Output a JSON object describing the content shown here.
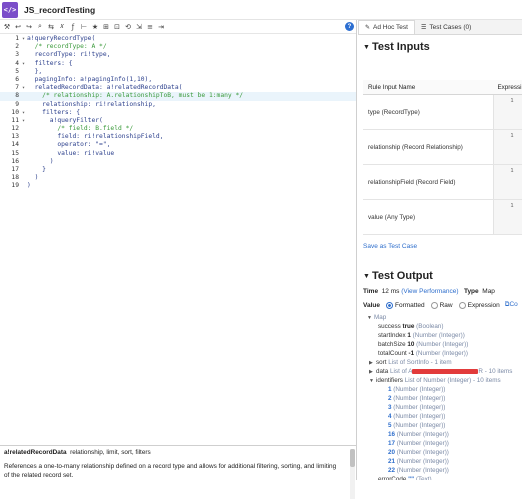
{
  "titlebar": {
    "icon": "</>",
    "title": "JS_recordTesting"
  },
  "toolbar": {
    "buttons": [
      "⚒",
      "↩",
      "↪",
      "⌕",
      "⇆",
      "𝑥",
      "ƒ",
      "⊢",
      "★",
      "⊞",
      "⊡",
      "⟲",
      "⇲",
      "≡",
      "⇥"
    ],
    "help": "?"
  },
  "code": {
    "lines": [
      {
        "n": "1",
        "fold": "▾",
        "text": "a!queryRecordType(",
        "cls": "c-fn"
      },
      {
        "n": "2",
        "fold": "",
        "text": "  /* recordType: A */",
        "cls": "c-comment"
      },
      {
        "n": "3",
        "fold": "",
        "text": "  recordType: ri!type,",
        "cls": "code-text"
      },
      {
        "n": "4",
        "fold": "▾",
        "text": "  filters: {",
        "cls": "code-text"
      },
      {
        "n": "5",
        "fold": "",
        "text": "  },",
        "cls": "code-text"
      },
      {
        "n": "6",
        "fold": "",
        "text": "  pagingInfo: a!pagingInfo(1,10),",
        "cls": "code-text"
      },
      {
        "n": "7",
        "fold": "▾",
        "text": "  relatedRecordData: a!relatedRecordData(",
        "cls": "code-text"
      },
      {
        "n": "8",
        "fold": "",
        "text": "    /* relationship: A.relationshipToB, must be 1:many */",
        "cls": "c-comment"
      },
      {
        "n": "9",
        "fold": "",
        "text": "    relationship: ri!relationship,",
        "cls": "code-text"
      },
      {
        "n": "10",
        "fold": "▾",
        "text": "    filters: {",
        "cls": "code-text"
      },
      {
        "n": "11",
        "fold": "▾",
        "text": "      a!queryFilter(",
        "cls": "code-text"
      },
      {
        "n": "12",
        "fold": "",
        "text": "        /* field: B.field */",
        "cls": "c-comment"
      },
      {
        "n": "13",
        "fold": "",
        "text": "        field: ri!relationshipField,",
        "cls": "code-text"
      },
      {
        "n": "14",
        "fold": "",
        "text": "        operator: \"=\",",
        "cls": "code-text"
      },
      {
        "n": "15",
        "fold": "",
        "text": "        value: ri!value",
        "cls": "code-text"
      },
      {
        "n": "16",
        "fold": "",
        "text": "      )",
        "cls": "code-text"
      },
      {
        "n": "17",
        "fold": "",
        "text": "    }",
        "cls": "code-text"
      },
      {
        "n": "18",
        "fold": "",
        "text": "  )",
        "cls": "code-text"
      },
      {
        "n": "19",
        "fold": "",
        "text": ")",
        "cls": "code-text"
      }
    ]
  },
  "doc": {
    "fn_name": "a!relatedRecordData",
    "params": "relationship, limit, sort, filters",
    "description": "References a one-to-many relationship defined on a record type and allows for additional filtering, sorting, and limiting of the related record set."
  },
  "tabs": [
    {
      "icon": "✎",
      "label": "Ad Hoc Test",
      "active": true
    },
    {
      "icon": "☰",
      "label": "Test Cases (0)",
      "active": false
    }
  ],
  "test_inputs": {
    "title": "Test Inputs",
    "col_name": "Rule Input Name",
    "col_expr": "Expressi",
    "rows": [
      {
        "name": "type (RecordType)",
        "line": "1"
      },
      {
        "name": "relationship (Record Relationship)",
        "line": "1"
      },
      {
        "name": "relationshipField (Record Field)",
        "line": "1"
      },
      {
        "name": "value (Any Type)",
        "line": "1"
      }
    ],
    "save_link": "Save as Test Case"
  },
  "test_output": {
    "title": "Test Output",
    "time_label": "Time",
    "time_value": "12 ms",
    "perf_link": "(View Performance)",
    "type_label": "Type",
    "type_value": "Map",
    "value_label": "Value",
    "radios": [
      "Formatted",
      "Raw",
      "Expression"
    ],
    "copy_label": "Co",
    "tree": {
      "root": "Map",
      "success": {
        "key": "success",
        "val": "true",
        "type": "(Boolean)"
      },
      "startIndex": {
        "key": "startIndex",
        "val": "1",
        "type": "(Number (Integer))"
      },
      "batchSize": {
        "key": "batchSize",
        "val": "10",
        "type": "(Number (Integer))"
      },
      "totalCount": {
        "key": "totalCount",
        "val": "-1",
        "type": "(Number (Integer))"
      },
      "sort": {
        "key": "sort",
        "type": "List of SortInfo - 1 item"
      },
      "data": {
        "key": "data",
        "type_prefix": "List of A",
        "type_suffix": "R - 10 items"
      },
      "identifiers": {
        "key": "identifiers",
        "type": "List of Number (Integer) - 10 items"
      },
      "ids": [
        {
          "val": "1",
          "type": "(Number (Integer))"
        },
        {
          "val": "2",
          "type": "(Number (Integer))"
        },
        {
          "val": "3",
          "type": "(Number (Integer))"
        },
        {
          "val": "4",
          "type": "(Number (Integer))"
        },
        {
          "val": "5",
          "type": "(Number (Integer))"
        },
        {
          "val": "16",
          "type": "(Number (Integer))"
        },
        {
          "val": "17",
          "type": "(Number (Integer))"
        },
        {
          "val": "20",
          "type": "(Number (Integer))"
        },
        {
          "val": "21",
          "type": "(Number (Integer))"
        },
        {
          "val": "22",
          "type": "(Number (Integer))"
        }
      ],
      "errorCode": {
        "key": "errorCode",
        "val": "\"\"",
        "type": "(Text)"
      }
    }
  },
  "colors": {
    "accent": "#2e6ecc",
    "app_icon": "#7b4ec9",
    "comment": "#3a9a3a",
    "redaction": "#e23b3b"
  }
}
